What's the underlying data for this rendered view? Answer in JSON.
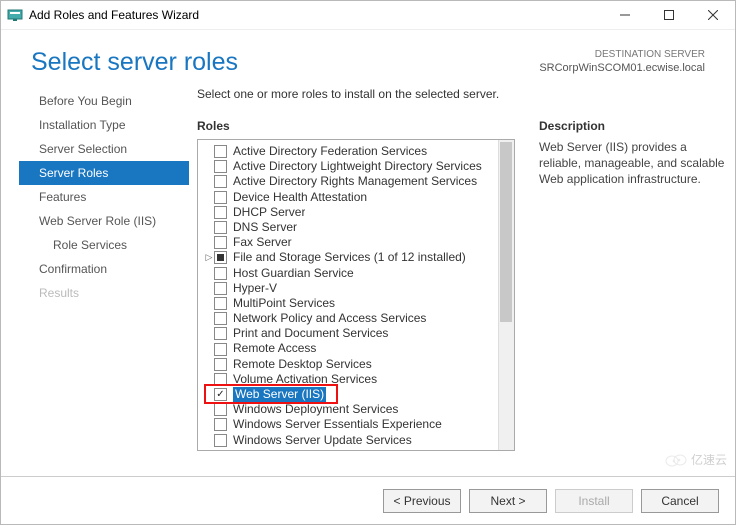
{
  "window": {
    "title": "Add Roles and Features Wizard"
  },
  "header": {
    "title": "Select server roles",
    "dest_label": "DESTINATION SERVER",
    "dest_server": "SRCorpWinSCOM01.ecwise.local"
  },
  "sidebar": {
    "items": [
      {
        "label": "Before You Begin",
        "state": "normal"
      },
      {
        "label": "Installation Type",
        "state": "normal"
      },
      {
        "label": "Server Selection",
        "state": "normal"
      },
      {
        "label": "Server Roles",
        "state": "selected"
      },
      {
        "label": "Features",
        "state": "normal"
      },
      {
        "label": "Web Server Role (IIS)",
        "state": "normal"
      },
      {
        "label": "Role Services",
        "state": "sub"
      },
      {
        "label": "Confirmation",
        "state": "normal"
      },
      {
        "label": "Results",
        "state": "disabled"
      }
    ]
  },
  "main": {
    "instruction": "Select one or more roles to install on the selected server.",
    "roles_label": "Roles",
    "desc_label": "Description",
    "description": "Web Server (IIS) provides a reliable, manageable, and scalable Web application infrastructure.",
    "roles": [
      {
        "label": "Active Directory Federation Services",
        "checked": false
      },
      {
        "label": "Active Directory Lightweight Directory Services",
        "checked": false
      },
      {
        "label": "Active Directory Rights Management Services",
        "checked": false
      },
      {
        "label": "Device Health Attestation",
        "checked": false
      },
      {
        "label": "DHCP Server",
        "checked": false
      },
      {
        "label": "DNS Server",
        "checked": false
      },
      {
        "label": "Fax Server",
        "checked": false
      },
      {
        "label": "File and Storage Services (1 of 12 installed)",
        "checked": "partial",
        "expandable": true
      },
      {
        "label": "Host Guardian Service",
        "checked": false
      },
      {
        "label": "Hyper-V",
        "checked": false
      },
      {
        "label": "MultiPoint Services",
        "checked": false
      },
      {
        "label": "Network Policy and Access Services",
        "checked": false
      },
      {
        "label": "Print and Document Services",
        "checked": false
      },
      {
        "label": "Remote Access",
        "checked": false
      },
      {
        "label": "Remote Desktop Services",
        "checked": false
      },
      {
        "label": "Volume Activation Services",
        "checked": false
      },
      {
        "label": "Web Server (IIS)",
        "checked": true,
        "selected": true,
        "redbox": true
      },
      {
        "label": "Windows Deployment Services",
        "checked": false
      },
      {
        "label": "Windows Server Essentials Experience",
        "checked": false
      },
      {
        "label": "Windows Server Update Services",
        "checked": false
      }
    ]
  },
  "footer": {
    "previous": "< Previous",
    "next": "Next >",
    "install": "Install",
    "cancel": "Cancel"
  },
  "watermark": "亿速云"
}
